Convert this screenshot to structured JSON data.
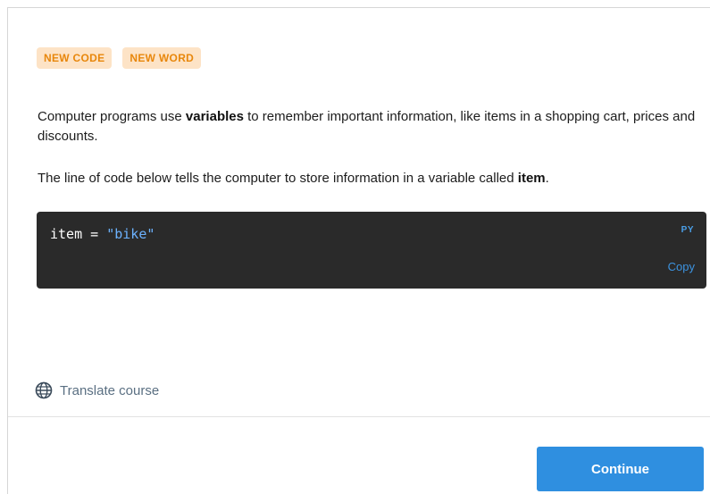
{
  "badges": [
    "NEW CODE",
    "NEW WORD"
  ],
  "intro": {
    "before": "Computer programs use ",
    "keyword": "variables",
    "after": " to remember important information, like items in a shopping cart, prices and discounts."
  },
  "explain": {
    "before": "The line of code below tells the computer to store information in a variable called ",
    "keyword": "item",
    "after": "."
  },
  "code": {
    "var": "item",
    "op": " = ",
    "value": "\"bike\"",
    "language": "PY",
    "copy_label": "Copy"
  },
  "footer": {
    "translate_label": "Translate course",
    "translate_icon": "globe-icon",
    "continue_label": "Continue"
  },
  "colors": {
    "badge_bg": "#fde3c6",
    "badge_text": "#e8870c",
    "code_bg": "#2a2a2a",
    "code_string": "#6cb2ff",
    "accent": "#2f8fe0"
  }
}
